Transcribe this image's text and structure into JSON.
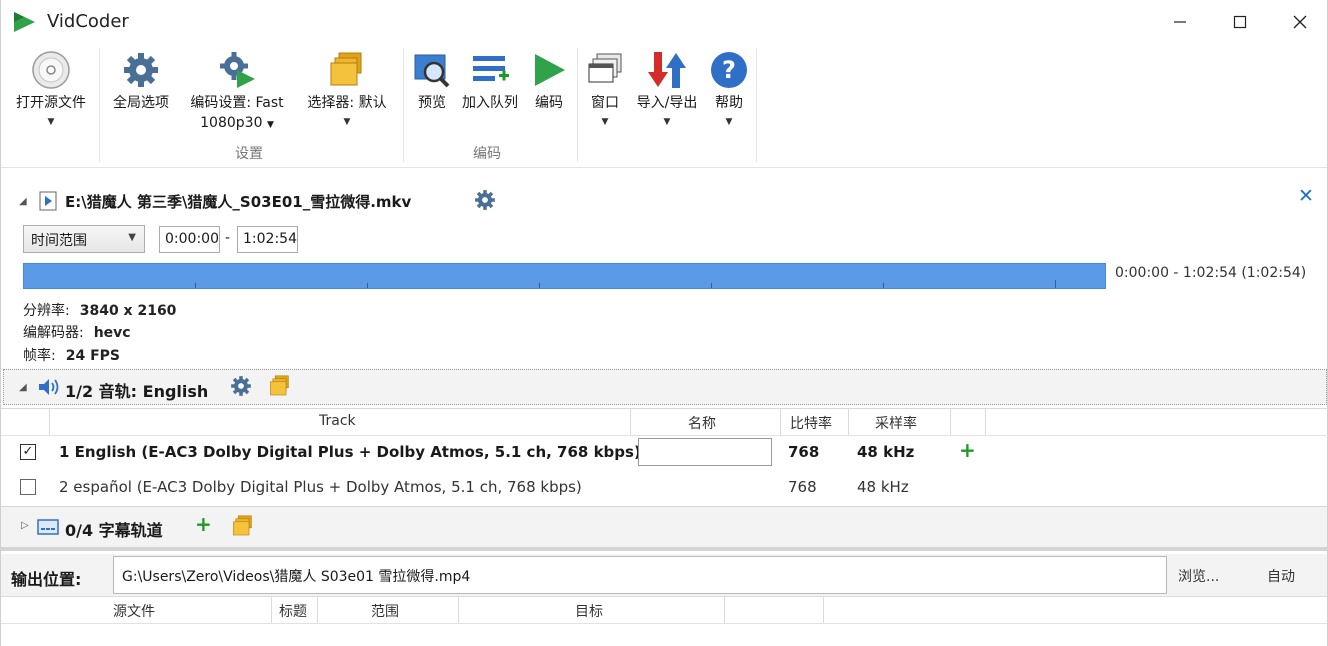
{
  "app": {
    "title": "VidCoder"
  },
  "window_controls": {
    "minimize": "—",
    "maximize": "☐",
    "close": "✕"
  },
  "ribbon": {
    "open_source": {
      "label": "打开源文件"
    },
    "global_options": {
      "label": "全局选项"
    },
    "encode_settings": {
      "label": "编码设置: Fast",
      "label2": "1080p30"
    },
    "picker": {
      "label": "选择器: 默认"
    },
    "preview": {
      "label": "预览"
    },
    "add_to_queue": {
      "label": "加入队列"
    },
    "encode": {
      "label": "编码"
    },
    "window": {
      "label": "窗口"
    },
    "import_export": {
      "label": "导入/导出"
    },
    "help": {
      "label": "帮助"
    },
    "groups": {
      "settings": "设置",
      "encoding": "编码"
    }
  },
  "source": {
    "path": "E:\\猎魔人 第三季\\猎魔人_S03E01_雪拉微得.mkv",
    "range_type": "时间范围",
    "start": "0:00:00",
    "dash": "-",
    "end": "1:02:54",
    "timeline_text": "0:00:00 - 1:02:54   (1:02:54)",
    "info": {
      "resolution_label": "分辨率:",
      "resolution": "3840 x 2160",
      "codec_label": "编解码器:",
      "codec": "hevc",
      "framerate_label": "帧率:",
      "framerate": "24 FPS"
    }
  },
  "audio": {
    "title": "1/2 音轨: English",
    "columns": [
      "Track",
      "名称",
      "比特率",
      "采样率"
    ],
    "tracks": [
      {
        "checked": true,
        "track": "1 English (E-AC3 Dolby Digital Plus + Dolby Atmos, 5.1 ch, 768 kbps)",
        "name": "",
        "bitrate": "768",
        "samplerate": "48 kHz",
        "add": "+"
      },
      {
        "checked": false,
        "track": "2 español (E-AC3 Dolby Digital Plus + Dolby Atmos, 5.1 ch, 768 kbps)",
        "bitrate": "768",
        "samplerate": "48 kHz"
      }
    ]
  },
  "subtitles": {
    "title": "0/4 字幕轨道",
    "add": "+"
  },
  "output": {
    "label": "输出位置:",
    "path": "G:\\Users\\Zero\\Videos\\猎魔人 S03e01 雪拉微得.mp4",
    "browse": "浏览...",
    "auto": "自动"
  },
  "queue": {
    "columns": [
      "源文件",
      "标题",
      "范围",
      "目标"
    ]
  },
  "colors": {
    "accent": "#1e73c8",
    "timeline": "#5b9ae6",
    "green": "#1d9a2a",
    "red": "#d42b2b"
  }
}
